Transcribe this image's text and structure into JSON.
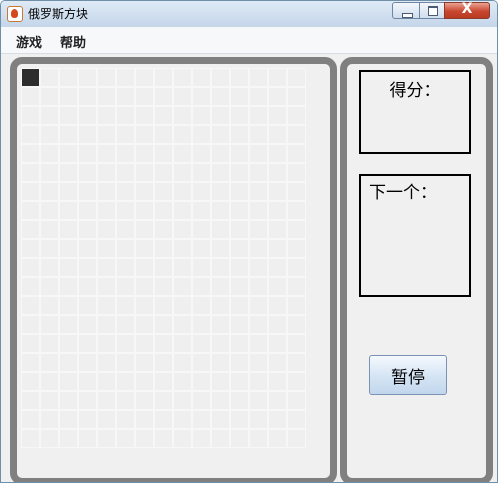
{
  "window": {
    "title": "俄罗斯方块",
    "close_symbol": "X",
    "icon": "java-cup-icon"
  },
  "menubar": {
    "items": [
      {
        "label": "游戏"
      },
      {
        "label": "帮助"
      }
    ]
  },
  "game_board": {
    "cols": 15,
    "rows": 20,
    "active_cells": [
      {
        "col": 0,
        "row": 0
      }
    ]
  },
  "side_panel": {
    "score_label": "得分：",
    "next_label": "下一个：",
    "pause_label": "暂停"
  },
  "colors": {
    "frame": "#808080",
    "block": "#2d2d2d",
    "background": "#f0f0f0"
  }
}
